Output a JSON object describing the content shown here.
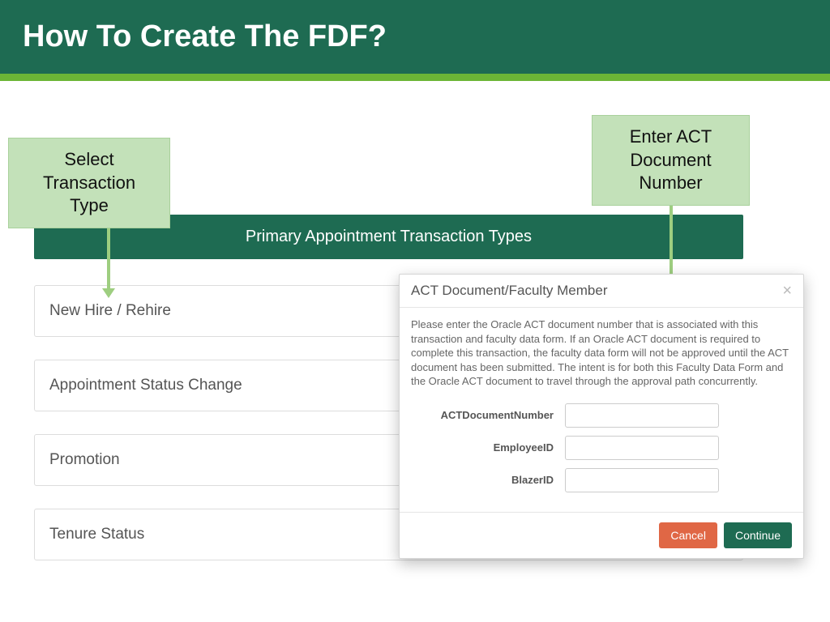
{
  "banner": {
    "title": "How To Create The FDF?"
  },
  "callouts": {
    "left": "Select Transaction Type",
    "right": "Enter ACT Document Number"
  },
  "section_header": "Primary Appointment Transaction Types",
  "transaction_types": [
    "New Hire / Rehire",
    "Appointment Status Change",
    "Promotion",
    "Tenure Status"
  ],
  "dialog": {
    "title": "ACT Document/Faculty Member",
    "description": "Please enter the Oracle ACT document number that is associated with this transaction and faculty data form. If an Oracle ACT document is required to complete this transaction, the faculty data form will not be approved until the ACT document has been submitted. The intent is for both this Faculty Data Form and the Oracle ACT document to travel through the approval path concurrently.",
    "fields": {
      "act_label": "ACTDocumentNumber",
      "emp_label": "EmployeeID",
      "blazer_label": "BlazerID"
    },
    "buttons": {
      "cancel": "Cancel",
      "continue": "Continue"
    }
  }
}
